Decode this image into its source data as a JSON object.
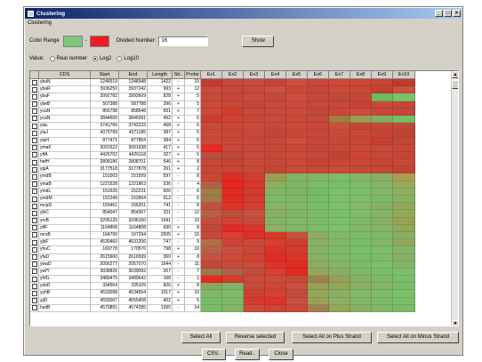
{
  "window": {
    "title": "Clustering",
    "menu_label": "Clustering"
  },
  "controls": {
    "color_range_label": "Color Range",
    "dash": "-",
    "low_color": "#7fc97a",
    "high_color": "#ee1c24",
    "divided_number_label": "Divided Number:",
    "divided_number_value": "16",
    "show_label": "Show",
    "value_label": "Value:",
    "radio_real": "Real number",
    "radio_log2": "Log2",
    "radio_log10": "Log10"
  },
  "table": {
    "headers": [
      "",
      "CDS",
      "Start",
      "End",
      "Length",
      "Str..",
      "Probe",
      "Ex1",
      "Ex2",
      "Ex3",
      "Ex4",
      "Ex5",
      "Ex6",
      "Ex7",
      "Ex8",
      "Ex9",
      "Ex10"
    ],
    "rows": [
      [
        "ybaN",
        "1246519",
        "1248348",
        "1422",
        "-",
        "15"
      ],
      [
        "ybaR",
        "3936250",
        "3937242",
        "993",
        "+",
        "12"
      ],
      [
        "ybaF",
        "3992782",
        "3993609",
        "828",
        "+",
        "5"
      ],
      [
        "ybeB",
        "507388",
        "587788",
        "396",
        "+",
        "5"
      ],
      [
        "ycaN",
        "856798",
        "858548",
        "561",
        "+",
        "7"
      ],
      [
        "ycaN",
        "3844600",
        "3845091",
        "492",
        "+",
        "6"
      ],
      [
        "ylaL",
        "3741766",
        "3742233",
        "468",
        "+",
        "6"
      ],
      [
        "ylaJ",
        "4370799",
        "4371185",
        "387",
        "+",
        "5"
      ],
      [
        "ylaH",
        "877471",
        "877854",
        "384",
        "+",
        "6"
      ],
      [
        "ymaF",
        "3091522",
        "3091938",
        "417",
        "+",
        "5"
      ],
      [
        "ytfA",
        "4425702",
        "4426118",
        "327",
        "+",
        "5"
      ],
      [
        "hefH",
        "2808186",
        "2808701",
        "546",
        "+",
        "8"
      ],
      [
        "ygiA",
        "3177518",
        "3177878",
        "261",
        "+",
        "2"
      ],
      [
        "ymdB",
        "151003",
        "151599",
        "597",
        "-",
        "8"
      ],
      [
        "ymaB",
        "1221528",
        "1221863",
        "336",
        "-",
        "4"
      ],
      [
        "ymdL",
        "151626",
        "152231",
        "606",
        "-",
        "6"
      ],
      [
        "ymdM",
        "152249",
        "152854",
        "612",
        "-",
        "6"
      ],
      [
        "mcpD",
        "155461",
        "156201",
        "741",
        "-",
        "8"
      ],
      [
        "ybiC",
        "854047",
        "854367",
        "321",
        "-",
        "12"
      ],
      [
        "yrvB",
        "3295120",
        "3296160",
        "1041",
        "-",
        "10"
      ],
      [
        "ytfF",
        "1164808",
        "1164808",
        "690",
        "+",
        "8"
      ],
      [
        "mrsB",
        "164790",
        "167294",
        "2505",
        "+",
        "15"
      ],
      [
        "yjhF",
        "4530460",
        "4531206",
        "747",
        "-",
        "9"
      ],
      [
        "yhuC",
        "169778",
        "170576",
        "798",
        "+",
        "10"
      ],
      [
        "yfaD",
        "2615600",
        "2616599",
        "360",
        "+",
        "8"
      ],
      [
        "ywaD",
        "2056277",
        "2057070",
        "1644",
        "-",
        "11"
      ],
      [
        "ywfY",
        "3038826",
        "3039092",
        "267",
        "-",
        "7"
      ],
      [
        "yhfG",
        "3489475",
        "3489642",
        "168",
        "-",
        "1"
      ],
      [
        "ysbD",
        "334504",
        "335109",
        "606",
        "+",
        "8"
      ],
      [
        "yyhB",
        "4533098",
        "4534654",
        "1017",
        "+",
        "10"
      ],
      [
        "yjiD",
        "4555007",
        "4555408",
        "402",
        "+",
        "5"
      ],
      [
        "hsdB",
        "4570891",
        "4574285",
        "1395",
        "-",
        "14"
      ]
    ],
    "heat_colors": [
      [
        "#c43c30",
        "#c44a3a",
        "#c84a3c",
        "#c84438",
        "#cc4e3e",
        "#c8483a",
        "#d04838",
        "#cc4636",
        "#c84436",
        "#c03a30"
      ],
      [
        "#c84c3c",
        "#c44838",
        "#c8483a",
        "#cc5240",
        "#c8483a",
        "#c4463a",
        "#cc4a3a",
        "#c84838",
        "#c44032",
        "#c85040"
      ],
      [
        "#c84a3a",
        "#c4463a",
        "#c84c3c",
        "#c84838",
        "#cc4e3e",
        "#c8483a",
        "#c04838",
        "#c4463a",
        "#6cbc5c",
        "#78c468"
      ],
      [
        "#c84a3a",
        "#c84838",
        "#c4463a",
        "#c84a3a",
        "#cc4a3c",
        "#c8483a",
        "#c84838",
        "#c44434",
        "#c84838",
        "#c4463a"
      ],
      [
        "#d04838",
        "#d43c30",
        "#c84a3c",
        "#c44a3a",
        "#c84c3c",
        "#c04838",
        "#c8483a",
        "#cc4e3e",
        "#c84838",
        "#c44636"
      ],
      [
        "#cc3c30",
        "#d04434",
        "#c84838",
        "#c84a3a",
        "#c8483a",
        "#c44a3a",
        "#a08040",
        "#98a050",
        "#80b060",
        "#74c064"
      ],
      [
        "#c84a3a",
        "#c84838",
        "#c84c3c",
        "#c44a3a",
        "#cc4a3a",
        "#c8483a",
        "#c85040",
        "#c44636",
        "#c84838",
        "#c4463a"
      ],
      [
        "#cc4a3a",
        "#c84636",
        "#c8483a",
        "#c44636",
        "#c84838",
        "#c8483a",
        "#c84a3a",
        "#c84838",
        "#c44636",
        "#c04434"
      ],
      [
        "#c84a3a",
        "#c84838",
        "#c8483a",
        "#c44a3a",
        "#cc4e3e",
        "#c8483a",
        "#c84838",
        "#c84636",
        "#c44030",
        "#c04836"
      ],
      [
        "#ec2820",
        "#c84838",
        "#c84a3a",
        "#c84838",
        "#c8483a",
        "#c4463a",
        "#c84838",
        "#c8483a",
        "#c44a3a",
        "#c84838"
      ],
      [
        "#b85040",
        "#c04838",
        "#c84a3a",
        "#c84838",
        "#cc4a3a",
        "#c84838",
        "#c04434",
        "#d04434",
        "#c84838",
        "#c4463a"
      ],
      [
        "#c84838",
        "#c44434",
        "#c84c3c",
        "#c84838",
        "#c84a3a",
        "#c44636",
        "#c84838",
        "#c8483a",
        "#c44636",
        "#c84838"
      ],
      [
        "#c84838",
        "#c84636",
        "#c8483a",
        "#c44636",
        "#cc4a3a",
        "#c84838",
        "#c84a3a",
        "#c84838",
        "#c44636",
        "#c04434"
      ],
      [
        "#c84838",
        "#e02c24",
        "#d43c30",
        "#98a050",
        "#80b468",
        "#7cb868",
        "#7cbc6c",
        "#80b868",
        "#88b064",
        "#a8a050"
      ],
      [
        "#b46048",
        "#e82820",
        "#d83828",
        "#8cb060",
        "#80b468",
        "#7cbc6c",
        "#74c068",
        "#7cbc6c",
        "#84b468",
        "#98a858"
      ],
      [
        "#9c8048",
        "#e02c24",
        "#d03c30",
        "#7cb864",
        "#80b468",
        "#74bc64",
        "#7cc06c",
        "#7cbc68",
        "#80b868",
        "#8cb060"
      ],
      [
        "#a47848",
        "#e02c24",
        "#d43c30",
        "#7cbc68",
        "#7cb868",
        "#78bc68",
        "#7cc06c",
        "#80bc6c",
        "#7cb868",
        "#88b064"
      ],
      [
        "#c05040",
        "#dc3428",
        "#d04034",
        "#88b468",
        "#84b868",
        "#7cbc68",
        "#7cc06c",
        "#84b868",
        "#88b064",
        "#90a858"
      ],
      [
        "#b86048",
        "#c04c3c",
        "#c85040",
        "#88b064",
        "#80b468",
        "#7cbc68",
        "#78c068",
        "#7cbc6c",
        "#84b468",
        "#94a858"
      ],
      [
        "#c84c3c",
        "#d04434",
        "#c44a3c",
        "#84b468",
        "#80b868",
        "#7cbc68",
        "#7cc06c",
        "#80b868",
        "#88b064",
        "#98a058"
      ],
      [
        "#c04838",
        "#e02c24",
        "#dc3428",
        "#8cb064",
        "#84b468",
        "#7cbc68",
        "#7cc06c",
        "#80b868",
        "#84b468",
        "#90a858"
      ],
      [
        "#c84838",
        "#d84030",
        "#e03024",
        "#d83828",
        "#c85040",
        "#8cac60",
        "#80b868",
        "#7cbc6c",
        "#80b868",
        "#88b064"
      ],
      [
        "#b07048",
        "#cc4438",
        "#c84c3c",
        "#d84030",
        "#d03c30",
        "#8cb064",
        "#80b868",
        "#7cbc68",
        "#84b468",
        "#90a858"
      ],
      [
        "#b86048",
        "#c85040",
        "#c84838",
        "#dc3428",
        "#d43c30",
        "#84b468",
        "#7cbc68",
        "#78c068",
        "#7cbc6c",
        "#84b468"
      ],
      [
        "#c85040",
        "#cc4838",
        "#d04434",
        "#e02c24",
        "#dc3428",
        "#88b064",
        "#80b868",
        "#7cbc68",
        "#80b868",
        "#88b064"
      ],
      [
        "#c04838",
        "#c44a3c",
        "#c84c3c",
        "#dc3428",
        "#e02c24",
        "#8cac60",
        "#84b468",
        "#7cbc68",
        "#7cc06c",
        "#84b468"
      ],
      [
        "#a07848",
        "#b06048",
        "#c04c3c",
        "#d84030",
        "#e02c24",
        "#90a858",
        "#88b064",
        "#80b868",
        "#7cbc68",
        "#7cc06c"
      ],
      [
        "#e82820",
        "#d43c30",
        "#cc4838",
        "#c84c3c",
        "#c04c3c",
        "#a08050",
        "#98a058",
        "#88b064",
        "#80b868",
        "#7cbc6c"
      ],
      [
        "#88a860",
        "#80b468",
        "#c04c3c",
        "#d04434",
        "#c85040",
        "#98a058",
        "#90a858",
        "#88b064",
        "#84b468",
        "#7cbc68"
      ],
      [
        "#80b868",
        "#7cbc68",
        "#d03c30",
        "#d84030",
        "#c44a3c",
        "#90a858",
        "#88b064",
        "#80b868",
        "#7cbc68",
        "#7cc06c"
      ],
      [
        "#78bc68",
        "#80b868",
        "#d43c30",
        "#dc3428",
        "#c85040",
        "#98a058",
        "#8cb064",
        "#84b468",
        "#7cbc68",
        "#78c068"
      ],
      [
        "#7cbc68",
        "#84b468",
        "#c84c3c",
        "#d04434",
        "#cc4838",
        "#a08050",
        "#94a858",
        "#88b064",
        "#80b868",
        "#7cbc68"
      ]
    ]
  },
  "buttons": {
    "select_all": "Select All",
    "reverse_selected": "Reverse selected",
    "select_all_plus": "Select All on Plus Strand",
    "select_all_minus": "Select All on Minus Strand",
    "csv": "CSV..",
    "read": "Read..",
    "close": "Close"
  }
}
